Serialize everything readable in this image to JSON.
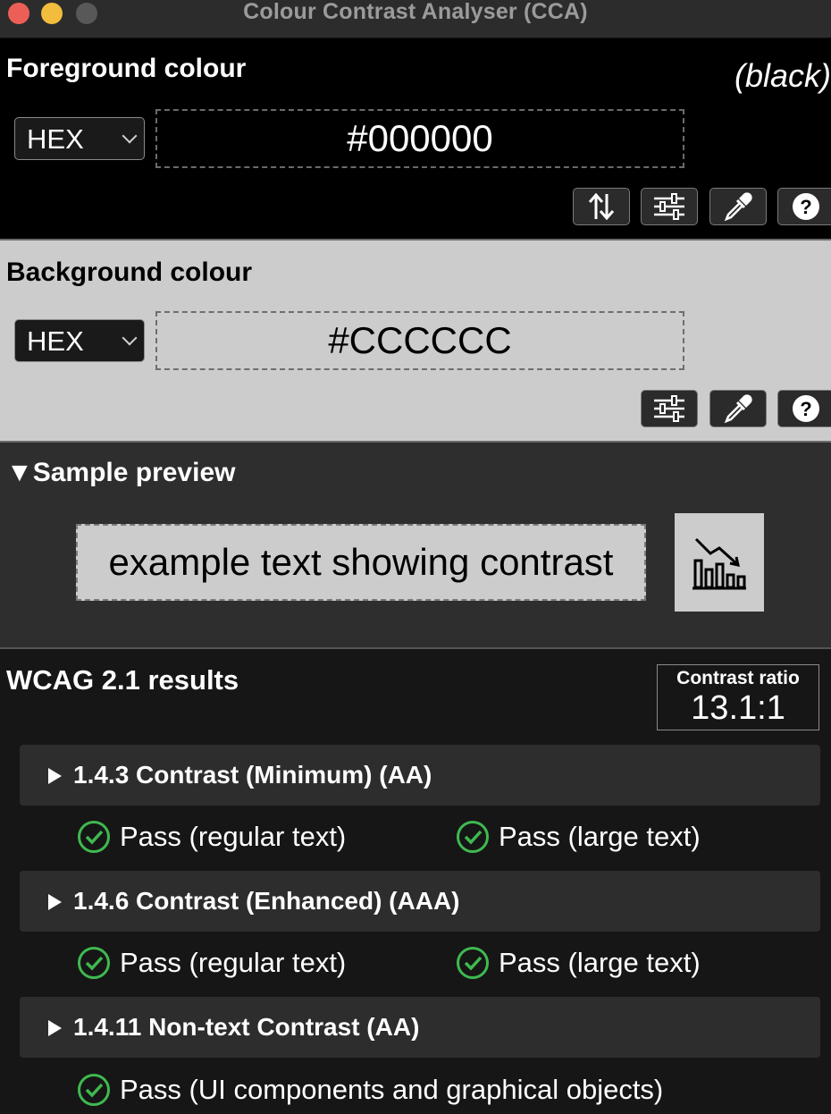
{
  "window": {
    "title": "Colour Contrast Analyser (CCA)"
  },
  "foreground": {
    "title": "Foreground colour",
    "color_name": "(black)",
    "format": "HEX",
    "value": "#000000",
    "color": "#000000",
    "buttons": [
      "swap-icon",
      "sliders-icon",
      "eyedropper-icon",
      "help-icon"
    ]
  },
  "background": {
    "title": "Background colour",
    "format": "HEX",
    "value": "#CCCCCC",
    "color": "#CCCCCC",
    "buttons": [
      "sliders-icon",
      "eyedropper-icon",
      "help-icon"
    ]
  },
  "preview": {
    "title": "Sample preview",
    "sample_text": "example text showing contrast"
  },
  "results": {
    "title": "WCAG 2.1 results",
    "ratio_label": "Contrast ratio",
    "ratio_value": "13.1:1",
    "criteria": [
      {
        "label": "1.4.3 Contrast (Minimum) (AA)",
        "results": [
          "Pass (regular text)",
          "Pass (large text)"
        ]
      },
      {
        "label": "1.4.6 Contrast (Enhanced) (AAA)",
        "results": [
          "Pass (regular text)",
          "Pass (large text)"
        ]
      },
      {
        "label": "1.4.11 Non-text Contrast (AA)",
        "results": [
          "Pass (UI components and graphical objects)"
        ]
      }
    ]
  },
  "colors": {
    "pass_green": "#3fb950",
    "section_divider": "#6a6a6a"
  }
}
